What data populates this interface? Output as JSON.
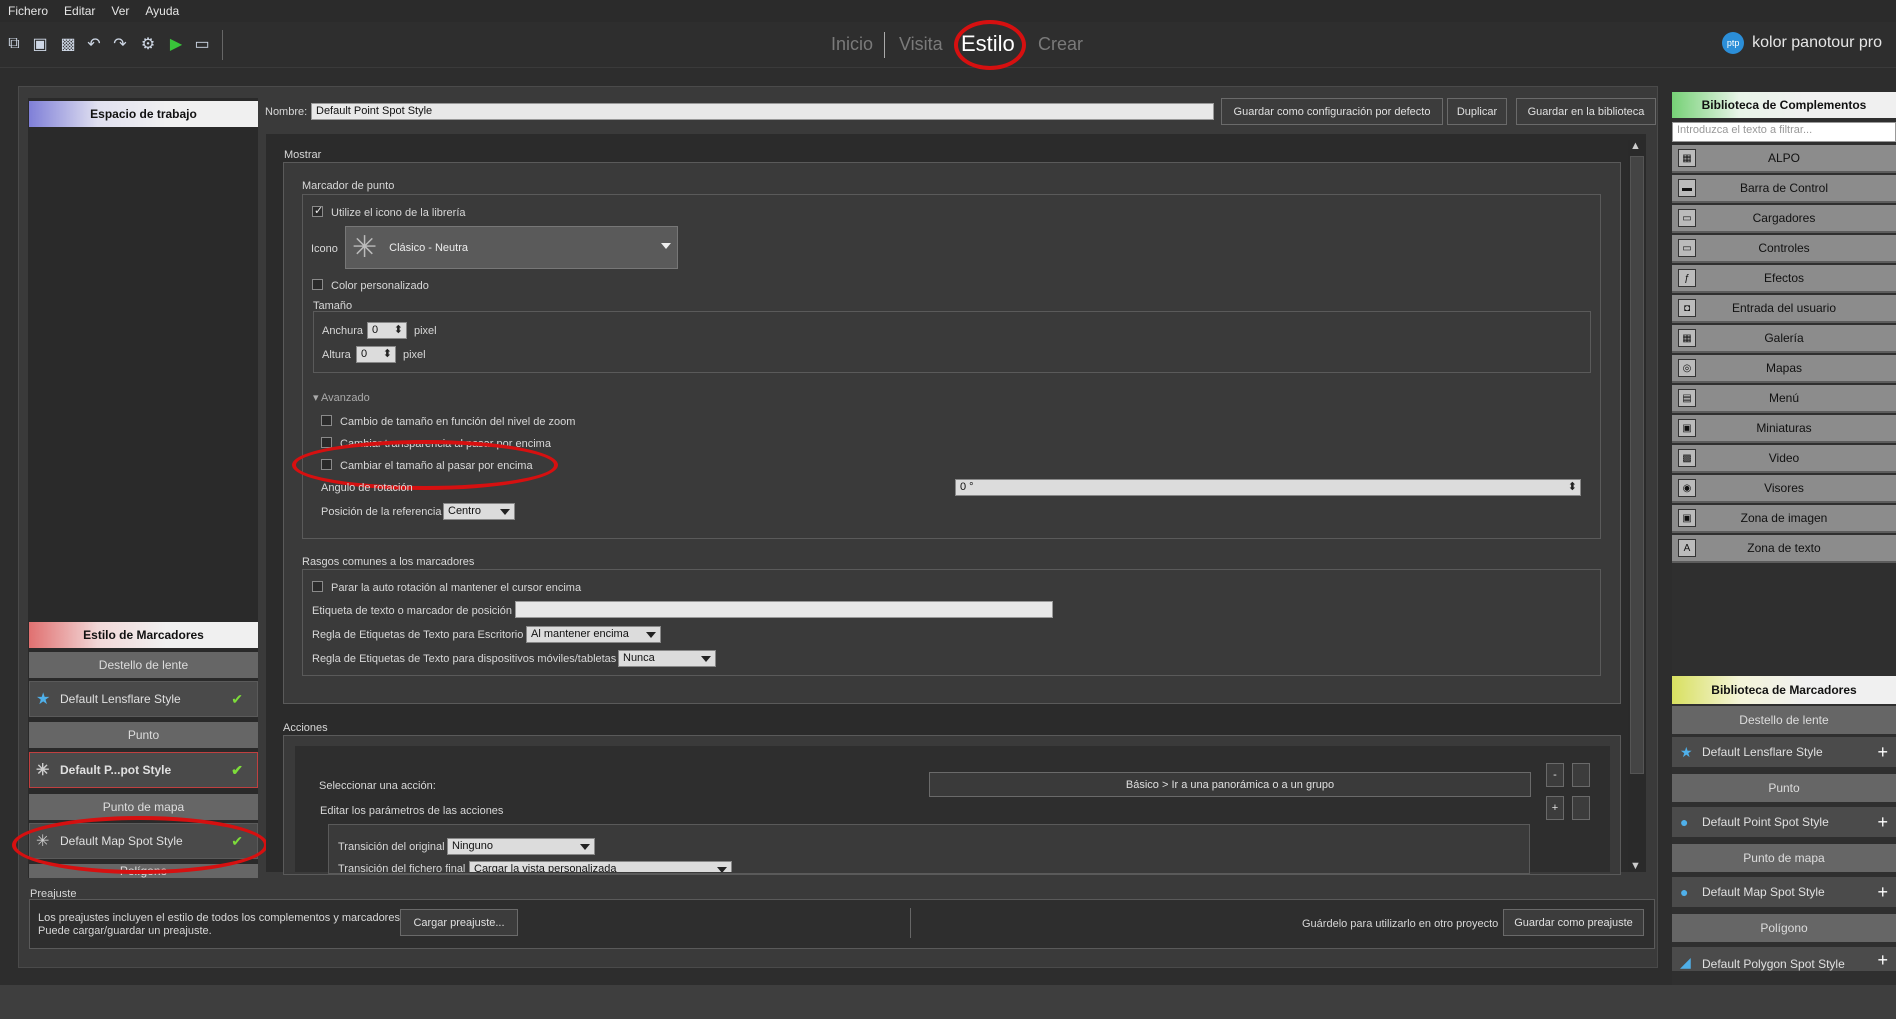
{
  "menubar": [
    "Fichero",
    "Editar",
    "Ver",
    "Ayuda"
  ],
  "nav": {
    "tabs": [
      "Inicio",
      "Visita",
      "Estilo",
      "Crear"
    ],
    "active": "Estilo"
  },
  "brand": {
    "logo_text": "ptp",
    "name": "kolor panotour pro"
  },
  "left": {
    "workspace_header": "Espacio de trabajo",
    "markers_header": "Estilo de Marcadores",
    "cat_lensflare": "Destello de lente",
    "item_lensflare": "Default Lensflare Style",
    "cat_point": "Punto",
    "item_point": "Default P...pot Style",
    "cat_mappoint": "Punto de mapa",
    "item_map": "Default Map Spot Style",
    "cat_polygon": "Polígono"
  },
  "topbar": {
    "name_label": "Nombre:",
    "name_value": "Default Point Spot Style",
    "btn_default": "Guardar como configuración por defecto",
    "btn_duplicate": "Duplicar",
    "btn_library": "Guardar en la biblioteca"
  },
  "show": {
    "section": "Mostrar",
    "marker_group": "Marcador de punto",
    "use_library_icon": "Utilize el icono de la librería",
    "icon_label": "Icono",
    "icon_value": "Clásico - Neutra",
    "custom_color": "Color personalizado",
    "size_group": "Tamaño",
    "width_label": "Anchura",
    "width_value": "0",
    "height_label": "Altura",
    "height_value": "0",
    "unit": "pixel",
    "advanced": "Avanzado",
    "zoom_resize": "Cambio de tamaño en función del nivel de zoom",
    "hover_transparency": "Cambiar transparencia al pasar por encima",
    "hover_resize": "Cambiar el tamaño al pasar por encima",
    "rotation_label": "Angulo de rotación",
    "rotation_value": "0 °",
    "ref_label": "Posición de la referencia",
    "ref_value": "Centro"
  },
  "common": {
    "group": "Rasgos comunes a los marcadores",
    "stop_rotation": "Parar la auto rotación al mantener el cursor encima",
    "text_label": "Etiqueta de texto o marcador de posición",
    "desktop_rule_label": "Regla de Etiquetas de Texto para Escritorio",
    "desktop_rule_value": "Al mantener encima",
    "mobile_rule_label": "Regla de Etiquetas de Texto para dispositivos móviles/tabletas",
    "mobile_rule_value": "Nunca"
  },
  "actions": {
    "section": "Acciones",
    "select_label": "Seleccionar una acción:",
    "select_value": "Básico > Ir a una panorámica o a un grupo",
    "minus": "-",
    "plus": "+",
    "edit_params": "Editar los parámetros de las acciones",
    "orig_transition_label": "Transición del original",
    "orig_transition_value": "Ninguno",
    "final_transition_label": "Transición del fichero final",
    "final_transition_value": "Cargar la vista personalizada"
  },
  "preset": {
    "section": "Preajuste",
    "desc1": "Los preajustes incluyen el estilo de todos los complementos y marcadores.",
    "desc2": "Puede cargar/guardar un preajuste.",
    "load_btn": "Cargar preajuste...",
    "save_hint": "Guárdelo para utilizarlo en otro proyecto",
    "save_btn": "Guardar como preajuste"
  },
  "right": {
    "complements_header": "Biblioteca de Complementos",
    "filter_placeholder": "Introduzca el texto a filtrar...",
    "complements": [
      {
        "label": "ALPO",
        "icon": "alpo-icon",
        "glyph": "▦"
      },
      {
        "label": "Barra de Control",
        "icon": "control-bar-icon",
        "glyph": "▬"
      },
      {
        "label": "Cargadores",
        "icon": "loaders-icon",
        "glyph": "▭"
      },
      {
        "label": "Controles",
        "icon": "controls-icon",
        "glyph": "▭"
      },
      {
        "label": "Efectos",
        "icon": "effects-icon",
        "glyph": "ƒ"
      },
      {
        "label": "Entrada del usuario",
        "icon": "user-input-icon",
        "glyph": "◘"
      },
      {
        "label": "Galería",
        "icon": "gallery-icon",
        "glyph": "▦"
      },
      {
        "label": "Mapas",
        "icon": "maps-icon",
        "glyph": "◎"
      },
      {
        "label": "Menú",
        "icon": "menu-icon",
        "glyph": "▤"
      },
      {
        "label": "Miniaturas",
        "icon": "thumbnails-icon",
        "glyph": "▣"
      },
      {
        "label": "Video",
        "icon": "video-icon",
        "glyph": "▩"
      },
      {
        "label": "Visores",
        "icon": "viewers-icon",
        "glyph": "◉"
      },
      {
        "label": "Zona de imagen",
        "icon": "image-zone-icon",
        "glyph": "▣"
      },
      {
        "label": "Zona de texto",
        "icon": "text-zone-icon",
        "glyph": "A"
      }
    ],
    "markers_header": "Biblioteca de Marcadores",
    "cat_lensflare": "Destello de lente",
    "item_lensflare": "Default Lensflare Style",
    "cat_point": "Punto",
    "item_point": "Default Point Spot Style",
    "cat_mappoint": "Punto de mapa",
    "item_map": "Default Map Spot Style",
    "cat_polygon": "Polígono",
    "item_polygon": "Default Polygon Spot Style"
  },
  "colors": {
    "accent_red": "#d61010",
    "check_green": "#7ddc3a",
    "marker_blue": "#4fb0ea"
  }
}
